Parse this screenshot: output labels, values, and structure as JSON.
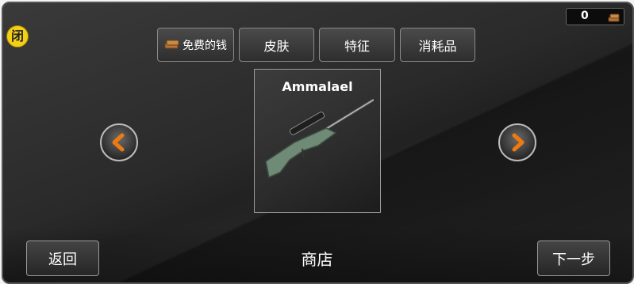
{
  "header": {
    "close_label": "闭",
    "currency_amount": "0"
  },
  "tabs": [
    {
      "label": "免费的钱"
    },
    {
      "label": "皮肤"
    },
    {
      "label": "特征"
    },
    {
      "label": "消耗品"
    }
  ],
  "item": {
    "name": "Ammalael",
    "icon": "sniper-rifle-icon"
  },
  "footer": {
    "back_label": "返回",
    "title": "商店",
    "next_label": "下一步"
  },
  "colors": {
    "accent_orange": "#f07a10",
    "close_yellow": "#f3cf17",
    "coin_brown": "#b5763a"
  }
}
